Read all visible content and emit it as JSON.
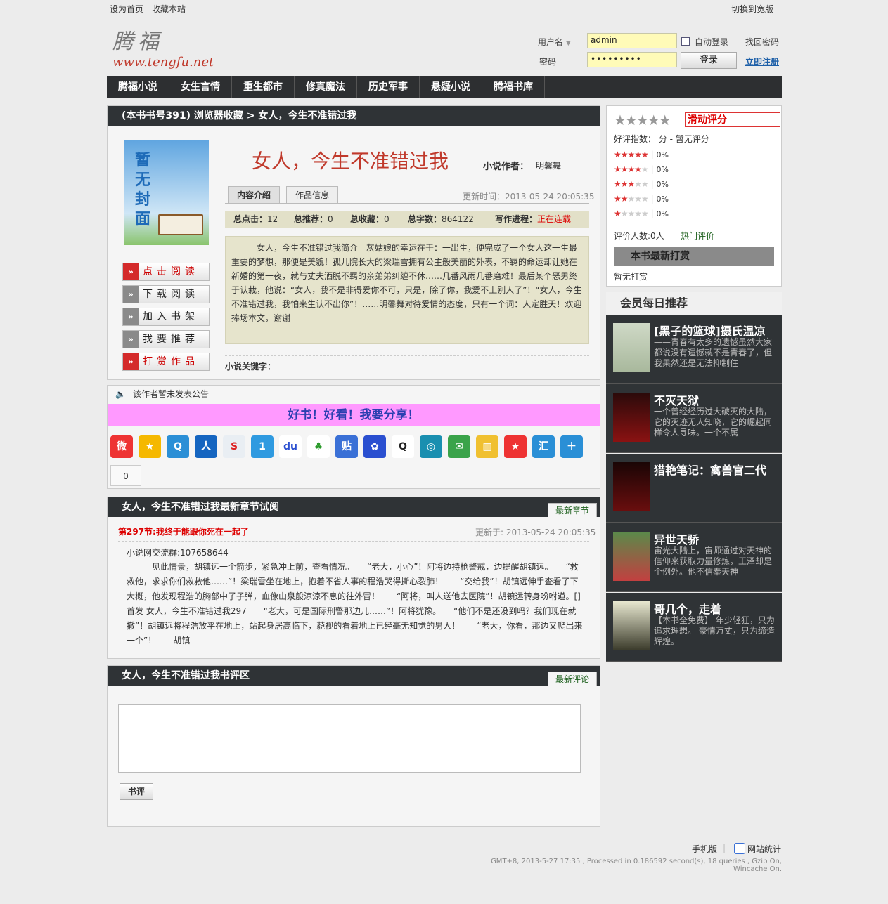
{
  "top": {
    "set_home": "设为首页",
    "bookmark": "收藏本站",
    "switch": "切换到宽版"
  },
  "logo": {
    "cn": "腾福",
    "en": "www.tengfu.net"
  },
  "login": {
    "user_label": "用户名",
    "user_value": "admin",
    "pass_label": "密码",
    "pass_value": "•••••••••",
    "auto": "自动登录",
    "find": "找回密码",
    "login_btn": "登录",
    "register": "立即注册"
  },
  "nav": [
    "腾福小说",
    "女生言情",
    "重生都市",
    "修真魔法",
    "历史军事",
    "悬疑小说",
    "腾福书库"
  ],
  "crumb": "(本书书号391) 浏览器收藏 > 女人，今生不准错过我",
  "book": {
    "cover_text": "暂无封面",
    "title": "女人，今生不准错过我",
    "author_label": "小说作者：",
    "author": "明馨舞",
    "tab_intro": "内容介绍",
    "tab_info": "作品信息",
    "updated": "更新时间：2013-05-24 20:05:35",
    "clicks_label": "总点击：",
    "clicks": "12",
    "recs_label": "总推荐：",
    "recs": "0",
    "favs_label": "总收藏：",
    "favs": "0",
    "words_label": "总字数：",
    "words": "864122",
    "progress_label": "写作进程：",
    "progress": "正在连载",
    "intro": "　　　女人，今生不准错过我简介　灰姑娘的幸运在于：一出生，便完成了一个女人这一生最重要的梦想，那便是美貌！孤儿院长大的梁瑞雪拥有公主般美丽的外表，不羁的命运却让她在新婚的第一夜，就与丈夫洒脱不羁的亲弟弟纠缠不休……几番风雨几番磨难！最后某个恶男终于认栽，他说：“女人，我不是非得爱你不可，只是，除了你，我爱不上别人了”！“女人，今生不准错过我，我怕来生认不出你”！……明馨舞对待爱情的态度，只有一个词：人定胜天！欢迎捧场本文，谢谢",
    "keywords_label": "小说关键字："
  },
  "side_buttons": [
    "点击阅读",
    "下载阅读",
    "加入书架",
    "我要推荐",
    "打赏作品"
  ],
  "notice": "该作者暂未发表公告",
  "share_text": "好书！好看！我要分享！",
  "share_count": "0",
  "share_icons": [
    "weibo-icon",
    "qzone-icon",
    "tencent-weibo-icon",
    "renren-icon",
    "sohu-icon",
    "kaixin-icon",
    "baidu-icon",
    "clover-icon",
    "tieba-icon",
    "baidu-hi-icon",
    "qq-icon",
    "douban-icon",
    "mail-icon",
    "chart-icon",
    "star-icon",
    "hui-icon",
    "plus-icon"
  ],
  "chapter": {
    "header": "女人，今生不准错过我最新章节试阅",
    "tag": "最新章节",
    "title": "第297节:我终于能跟你死在一起了",
    "updated": "更新于: 2013-05-24 20:05:35",
    "qq_group": "小说网交流群:107658644",
    "text": "　　　见此情景，胡镇远一个箭步，紧急冲上前，查看情况。　　“老大，小心”！阿将边持枪警戒，边提醒胡镇远。　　“救救他，求求你们救救他……”！梁瑞雪坐在地上，抱着不省人事的程浩哭得撕心裂肺！　　“交给我”！胡镇远伸手查看了下大概，他发现程浩的胸部中了子弹，血像山泉般涼涼不息的往外冒！　　“阿将，叫人送他去医院”！胡镇远转身吩咐道。[]　首发 女人，今生不准错过我297　　“老大，可是国际刑警那边儿……”！阿将犹豫。　　“他们不是还没到吗？我们现在就撤”！胡镇远将程浩放平在地上，站起身居高临下，藐视的看着地上已经毫无知觉的男人！　　“老大，你看，那边又爬出来一个”！　　胡镇"
  },
  "review": {
    "header": "女人，今生不准错过我书评区",
    "tag": "最新评论",
    "btn": "书评"
  },
  "rating": {
    "slide": "滑动评分",
    "index_label": "好评指数：",
    "index_value": "分 - 暂无评分",
    "pcts": [
      "0%",
      "0%",
      "0%",
      "0%",
      "0%"
    ],
    "count": "评价人数:0人",
    "hot": "热门评价",
    "reward_head": "本书最新打赏",
    "reward_none": "暂无打赏"
  },
  "recommend": {
    "header": "会员每日推荐",
    "items": [
      {
        "title": "[黑子的篮球]摄氏温凉",
        "desc": "——青春有太多的遗憾虽然大家都说没有遗憾就不是青春了，但我果然还是无法抑制住"
      },
      {
        "title": "不灭天狱",
        "desc": "一个曾经经历过大破灭的大陆，它的灭迹无人知晓，它的崛起同样令人寻味。一个不属"
      },
      {
        "title": "猎艳笔记：禽兽官二代",
        "desc": ""
      },
      {
        "title": "异世天骄",
        "desc": "宙光大陆上，宙师通过对天神的信仰来获取力量修炼，王泽却是个例外。他不信奉天神"
      },
      {
        "title": "哥几个，走着",
        "desc": "【本书全免费】 年少轻狂，只为追求理想。 豪情万丈，只为缔造辉煌。"
      }
    ]
  },
  "footer": {
    "mobile": "手机版",
    "stats": "网站统计",
    "info": "GMT+8, 2013-5-27 17:35 , Processed in 0.186592 second(s), 18 queries , Gzip On, Wincache On."
  },
  "colors": {
    "accent": "#c0392b",
    "nav_bg": "#2d2f31",
    "share_bg": "#ff99ff",
    "input_bg": "#fffbb8"
  }
}
